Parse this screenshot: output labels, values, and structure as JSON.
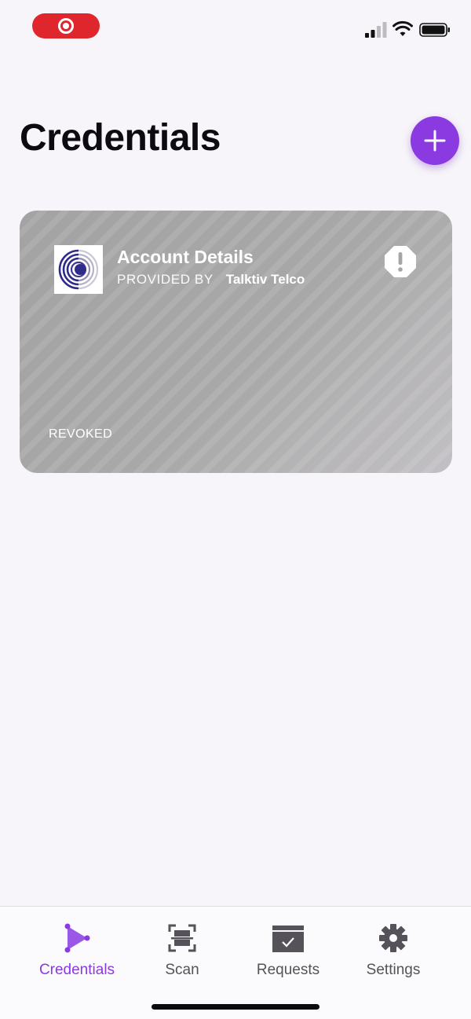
{
  "status_bar": {
    "recording_icon": "screen-recording-icon",
    "signal_icon": "cellular-signal-icon",
    "wifi_icon": "wifi-icon",
    "battery_icon": "battery-icon"
  },
  "header": {
    "title": "Credentials",
    "add_icon": "plus-icon"
  },
  "credentials": [
    {
      "title": "Account Details",
      "provided_by_label": "PROVIDED BY",
      "provider": "Talktiv Telco",
      "status": "REVOKED",
      "logo_icon": "concentric-circles-logo",
      "alert_icon": "exclamation-octagon-icon"
    }
  ],
  "tabs": [
    {
      "label": "Credentials",
      "icon": "credentials-triangle-icon",
      "active": true
    },
    {
      "label": "Scan",
      "icon": "scan-icon",
      "active": false
    },
    {
      "label": "Requests",
      "icon": "requests-inbox-icon",
      "active": false
    },
    {
      "label": "Settings",
      "icon": "gear-icon",
      "active": false
    }
  ],
  "colors": {
    "accent": "#8a3ae0",
    "background": "#f7f5f9",
    "card_revoked": "#a6a6a6",
    "recording": "#e0262d",
    "tab_inactive": "#55525a"
  }
}
